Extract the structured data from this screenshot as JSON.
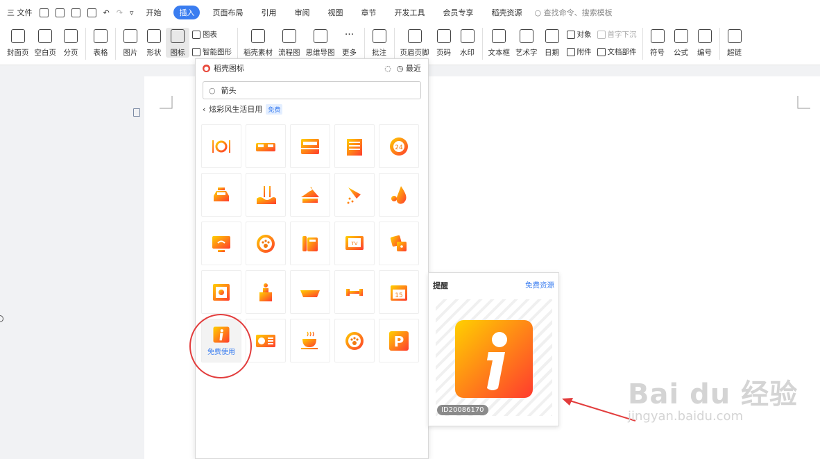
{
  "menubar": {
    "file": "三 文件",
    "tabs": [
      "开始",
      "插入",
      "页面布局",
      "引用",
      "审阅",
      "视图",
      "章节",
      "开发工具",
      "会员专享",
      "稻壳资源"
    ],
    "active_tab": "插入",
    "search": "查找命令、搜索模板"
  },
  "ribbon": {
    "b1": "封面页",
    "b2": "空白页",
    "b3": "分页",
    "b4": "表格",
    "b5": "图片",
    "b6": "形状",
    "b7": "图标",
    "s1": "图表",
    "s2": "智能图形",
    "b8": "稻壳素材",
    "b9": "流程图",
    "b10": "思维导图",
    "b11": "更多",
    "b12": "批注",
    "b13": "页眉页脚",
    "b14": "页码",
    "b15": "水印",
    "b16": "文本框",
    "b17": "艺术字",
    "b18": "日期",
    "s3": "对象",
    "s4": "附件",
    "s5": "首字下沉",
    "s6": "文档部件",
    "b19": "符号",
    "b20": "公式",
    "b21": "编号",
    "b22": "超链"
  },
  "panel": {
    "title": "稻壳图标",
    "recent": "最近",
    "search_value": "箭头",
    "category": "炫彩风生活日用",
    "category_badge": "免费",
    "hover_label": "免费使用"
  },
  "preview": {
    "title": "提醒",
    "link": "免费资源",
    "id": "ID20086170"
  },
  "watermark": {
    "brand": "Bai du 经验",
    "url": "jingyan.baidu.com"
  },
  "colors": {
    "accent": "#3a7df0",
    "icon_gradient_start": "#ffd000",
    "icon_gradient_end": "#ff3b2e",
    "annotation_red": "#e23c3c"
  },
  "icons": [
    "restaurant-icon",
    "bed-icon",
    "double-bed-icon",
    "hotel-building-icon",
    "service-24h-icon",
    "taxi-icon",
    "pool-icon",
    "hanger-icon",
    "shower-icon",
    "water-drop-icon",
    "wifi-monitor-icon",
    "pet-paw-icon",
    "telephone-icon",
    "tv-icon",
    "dice-icon",
    "safe-icon",
    "reception-icon",
    "bathtub-icon",
    "dumbbell-icon",
    "calendar-icon",
    "info-icon",
    "air-conditioner-icon",
    "coffee-icon",
    "pet-paw-circle-icon",
    "parking-icon"
  ]
}
